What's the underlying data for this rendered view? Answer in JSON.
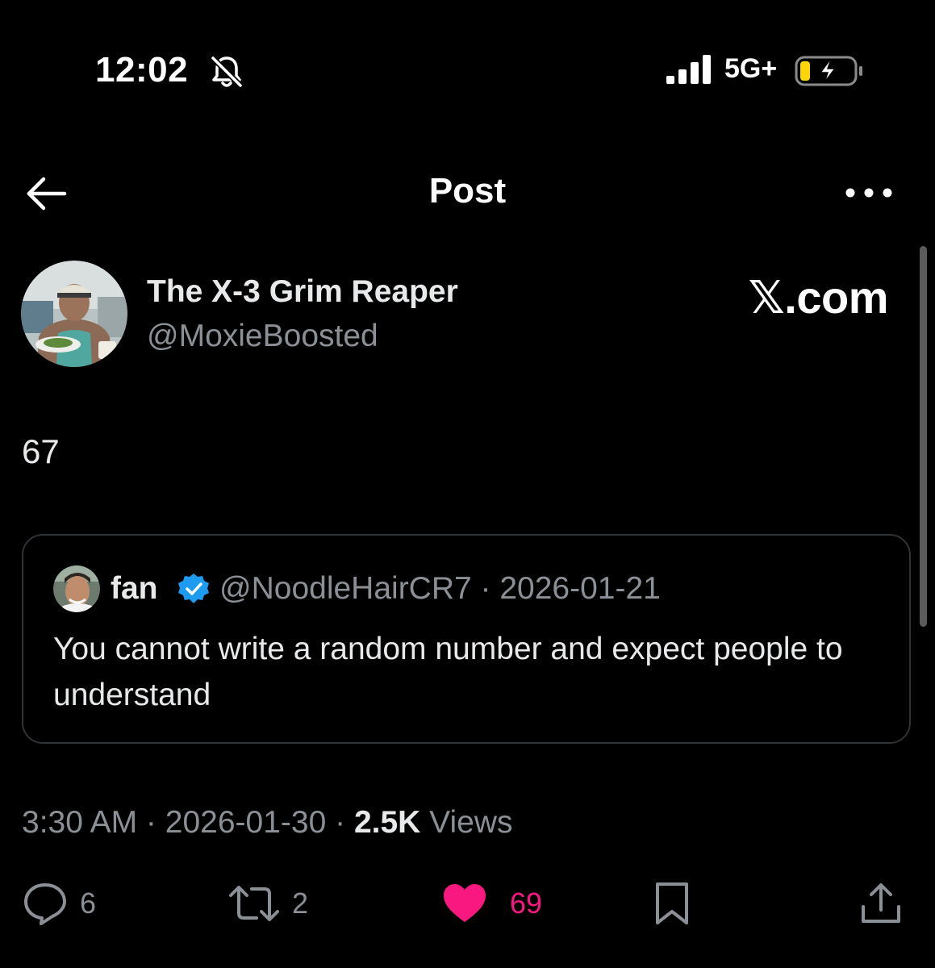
{
  "status_bar": {
    "time": "12:02",
    "network": "5G+",
    "icons": [
      "bell-off-icon",
      "signal-icon",
      "battery-charging-icon"
    ]
  },
  "header": {
    "title": "Post",
    "back_icon": "arrow-left-icon",
    "more_icon": "more-dots-icon"
  },
  "post": {
    "author_name": "The X-3 Grim Reaper",
    "author_handle": "@MoxieBoosted",
    "watermark": "𝕏.com",
    "text": "67",
    "quote": {
      "author_name": "fan",
      "verified": true,
      "handle_and_date": "@NoodleHairCR7 · 2026-01-21",
      "text": "You cannot write a random number and expect people to understand"
    },
    "time": "3:30 AM",
    "date": "2026-01-30",
    "views_count": "2.5K",
    "views_label": "Views"
  },
  "actions": {
    "replies": "6",
    "reposts": "2",
    "likes": "69",
    "liked": true
  },
  "colors": {
    "background": "#000000",
    "text": "#e7e9ea",
    "secondary_text": "#8b9096",
    "like_pink": "#f91880",
    "verified_blue": "#1d9bf0",
    "border": "#2f3336"
  }
}
